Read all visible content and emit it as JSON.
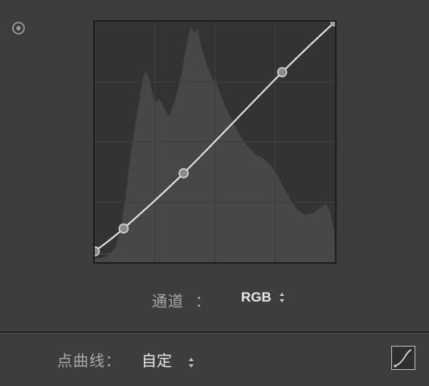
{
  "tone_curve": {
    "target_tool": "target-adjustment-icon",
    "channel": {
      "label": "通道",
      "colon": "：",
      "value": "RGB"
    },
    "point_curve": {
      "label": "点曲线：",
      "value": "自定"
    },
    "edit_point_curve_icon": "curve-edit-icon"
  },
  "colors": {
    "panel_bg": "#3d3d3d",
    "graph_bg": "#333333",
    "histogram": "#484848",
    "curve": "#e6e6e6",
    "grid": "#3e3e3e"
  },
  "curve_points": [
    {
      "input": 0.0,
      "output": 0.045
    },
    {
      "input": 0.12,
      "output": 0.14
    },
    {
      "input": 0.37,
      "output": 0.37
    },
    {
      "input": 0.78,
      "output": 0.79
    },
    {
      "input": 1.0,
      "output": 1.0
    }
  ]
}
